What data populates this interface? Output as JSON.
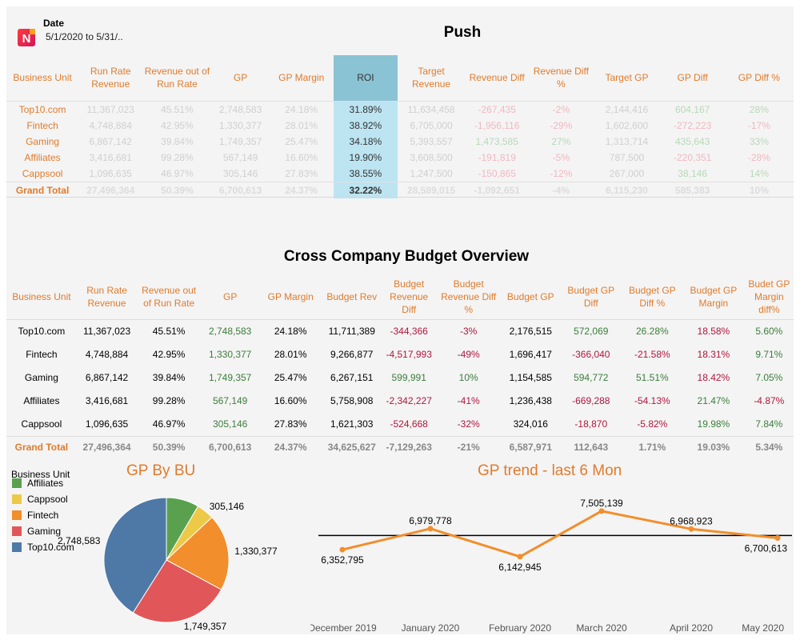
{
  "header": {
    "date_label": "Date",
    "date_value": "5/1/2020 to 5/31/..",
    "logo_icon": "brand-logo-icon",
    "logo_letter": "N"
  },
  "push": {
    "title": "Push",
    "columns": [
      "Business Unit",
      "Run Rate Revenue",
      "Revenue out of Run Rate",
      "GP",
      "GP Margin",
      "ROI",
      "Target Revenue",
      "Revenue Diff",
      "Revenue Diff %",
      "Target GP",
      "GP Diff",
      "GP Diff %"
    ],
    "rows": [
      [
        "Top10.com",
        "11,367,023",
        "45.51%",
        "2,748,583",
        "24.18%",
        "31.89%",
        "11,634,458",
        "-267,435",
        "-2%",
        "2,144,416",
        "604,167",
        "28%"
      ],
      [
        "Fintech",
        "4,748,884",
        "42.95%",
        "1,330,377",
        "28.01%",
        "38.92%",
        "6,705,000",
        "-1,956,116",
        "-29%",
        "1,602,600",
        "-272,223",
        "-17%"
      ],
      [
        "Gaming",
        "6,867,142",
        "39.84%",
        "1,749,357",
        "25.47%",
        "34.18%",
        "5,393,557",
        "1,473,585",
        "27%",
        "1,313,714",
        "435,643",
        "33%"
      ],
      [
        "Affiliates",
        "3,416,681",
        "99.28%",
        "567,149",
        "16.60%",
        "19.90%",
        "3,608,500",
        "-191,819",
        "-5%",
        "787,500",
        "-220,351",
        "-28%"
      ],
      [
        "Cappsool",
        "1,096,635",
        "46.97%",
        "305,146",
        "27.83%",
        "38.55%",
        "1,247,500",
        "-150,865",
        "-12%",
        "267,000",
        "38,146",
        "14%"
      ]
    ],
    "total": [
      "Grand Total",
      "27,496,364",
      "50.39%",
      "6,700,613",
      "24.37%",
      "32.22%",
      "28,589,015",
      "-1,092,651",
      "-4%",
      "6,115,230",
      "585,383",
      "10%"
    ]
  },
  "budget": {
    "title": "Cross Company Budget Overview",
    "columns": [
      "Business Unit",
      "Run Rate Revenue",
      "Revenue out of Run Rate",
      "GP",
      "GP Margin",
      "Budget Rev",
      "Budget Revenue Diff",
      "Budget Revenue Diff %",
      "Budget GP",
      "Budget GP Diff",
      "Budget GP Diff %",
      "Budget GP Margin",
      "Budet GP Margin diff%"
    ],
    "rows": [
      [
        "Top10.com",
        "11,367,023",
        "45.51%",
        "2,748,583",
        "24.18%",
        "11,711,389",
        "-344,366",
        "-3%",
        "2,176,515",
        "572,069",
        "26.28%",
        "18.58%",
        "5.60%"
      ],
      [
        "Fintech",
        "4,748,884",
        "42.95%",
        "1,330,377",
        "28.01%",
        "9,266,877",
        "-4,517,993",
        "-49%",
        "1,696,417",
        "-366,040",
        "-21.58%",
        "18.31%",
        "9.71%"
      ],
      [
        "Gaming",
        "6,867,142",
        "39.84%",
        "1,749,357",
        "25.47%",
        "6,267,151",
        "599,991",
        "10%",
        "1,154,585",
        "594,772",
        "51.51%",
        "18.42%",
        "7.05%"
      ],
      [
        "Affiliates",
        "3,416,681",
        "99.28%",
        "567,149",
        "16.60%",
        "5,758,908",
        "-2,342,227",
        "-41%",
        "1,236,438",
        "-669,288",
        "-54.13%",
        "21.47%",
        "-4.87%"
      ],
      [
        "Cappsool",
        "1,096,635",
        "46.97%",
        "305,146",
        "27.83%",
        "1,621,303",
        "-524,668",
        "-32%",
        "324,016",
        "-18,870",
        "-5.82%",
        "19.98%",
        "7.84%"
      ]
    ],
    "total": [
      "Grand Total",
      "27,496,364",
      "50.39%",
      "6,700,613",
      "24.37%",
      "34,625,627",
      "-7,129,263",
      "-21%",
      "6,587,971",
      "112,643",
      "1.71%",
      "19.03%",
      "5.34%"
    ]
  },
  "legend": {
    "title": "Business Unit",
    "items": [
      {
        "label": "Affiliates",
        "color": "#59a14f"
      },
      {
        "label": "Cappsool",
        "color": "#edc948"
      },
      {
        "label": "Fintech",
        "color": "#f28e2b"
      },
      {
        "label": "Gaming",
        "color": "#e15759"
      },
      {
        "label": "Top10.com",
        "color": "#4e79a7"
      }
    ]
  },
  "chart_data": [
    {
      "type": "pie",
      "title": "GP By BU",
      "slices": [
        {
          "label": "Affiliates",
          "value": 567149,
          "color": "#59a14f"
        },
        {
          "label": "Cappsool",
          "value": 305146,
          "color": "#edc948"
        },
        {
          "label": "Fintech",
          "value": 1330377,
          "color": "#f28e2b"
        },
        {
          "label": "Gaming",
          "value": 1749357,
          "color": "#e15759"
        },
        {
          "label": "Top10.com",
          "value": 2748583,
          "color": "#4e79a7"
        }
      ],
      "data_labels": [
        {
          "text": "305,146",
          "slice": 1
        },
        {
          "text": "1,330,377",
          "slice": 2
        },
        {
          "text": "1,749,357",
          "slice": 3
        },
        {
          "text": "2,748,583",
          "slice": 4
        }
      ]
    },
    {
      "type": "line",
      "title": "GP trend - last 6 Mon",
      "categories": [
        "December 2019",
        "January 2020",
        "February 2020",
        "March 2020",
        "April 2020",
        "May 2020"
      ],
      "values": [
        6352795,
        6979778,
        6142945,
        7505139,
        6968923,
        6700613
      ],
      "labels": [
        "6,352,795",
        "6,979,778",
        "6,142,945",
        "7,505,139",
        "6,968,923",
        "6,700,613"
      ],
      "reference_line": 6775000,
      "ylim": [
        5900000,
        8100000
      ],
      "line_color": "#f28e2b"
    }
  ]
}
